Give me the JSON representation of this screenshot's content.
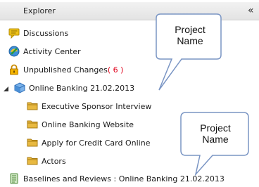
{
  "header": {
    "title": "Explorer",
    "collapse_glyph": "«"
  },
  "tree": {
    "top_items": [
      {
        "label": "Discussions",
        "icon": "discussions-icon"
      },
      {
        "label": "Activity Center",
        "icon": "activity-center-icon"
      },
      {
        "label": "Unpublished Changes",
        "count": "( 6 )",
        "icon": "lock-icon"
      }
    ],
    "project": {
      "label": "Online Banking 21.02.2013",
      "icon": "project-cube-icon",
      "expanded": true,
      "children": [
        {
          "label": "Executive Sponsor Interview",
          "icon": "folder-icon"
        },
        {
          "label": "Online Banking Website",
          "icon": "folder-icon"
        },
        {
          "label": "Apply for Credit Card Online",
          "icon": "folder-icon"
        },
        {
          "label": "Actors",
          "icon": "folder-icon"
        }
      ]
    },
    "baselines": {
      "label": "Baselines and Reviews : Online Banking 21.02.2013",
      "icon": "baselines-icon"
    }
  },
  "callouts": [
    {
      "line1": "Project",
      "line2": "Name"
    },
    {
      "line1": "Project",
      "line2": "Name"
    }
  ],
  "colors": {
    "count": "#e0001b",
    "callout_border": "#7a95c4",
    "folder": "#e8b941",
    "cube": "#4a8fd6"
  }
}
